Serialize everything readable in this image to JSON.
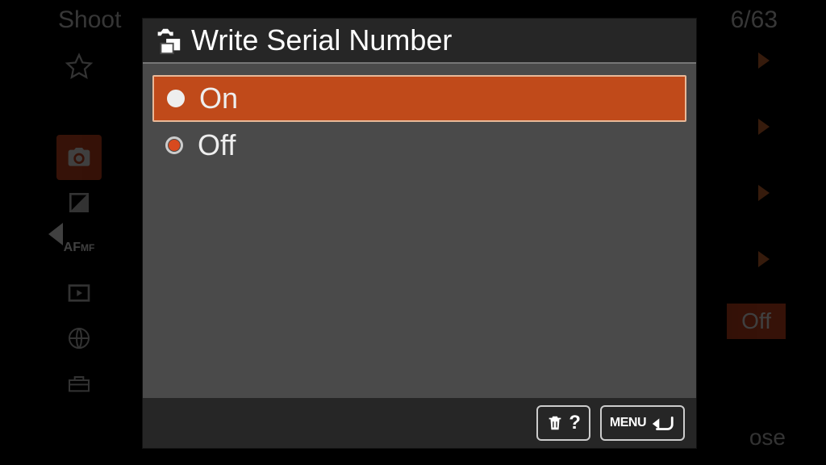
{
  "background": {
    "top_left_text": "Shoot",
    "page_counter": "6/63",
    "right_value_box": "Off",
    "bottom_right_text": "ose"
  },
  "dialog": {
    "title": "Write Serial Number",
    "options": [
      {
        "label": "On",
        "selected": true
      },
      {
        "label": "Off",
        "selected": false
      }
    ],
    "footer": {
      "help_symbol": "?",
      "menu_label": "MENU"
    }
  }
}
